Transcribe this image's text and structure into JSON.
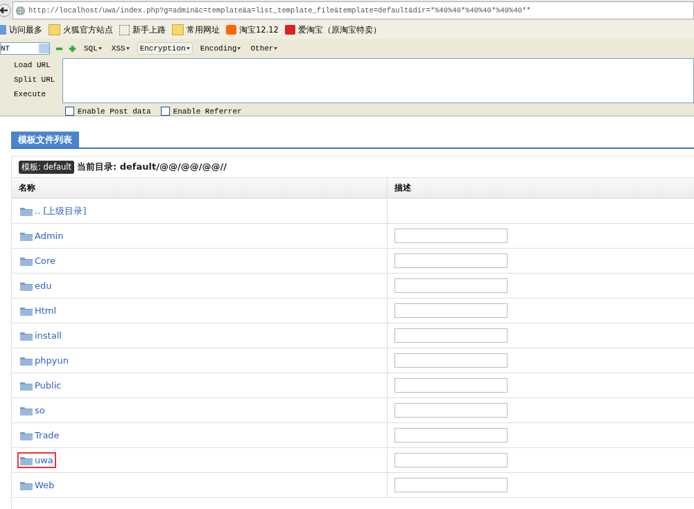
{
  "address_bar": {
    "url": "http://localhost/uwa/index.php?g=admin&c=template&a=list_template_file&template=default&dir=*%40%40*%40%40*%40%40**"
  },
  "bookmarks": [
    {
      "label": "访问最多",
      "kind": "page"
    },
    {
      "label": "火狐官方站点",
      "kind": "folder"
    },
    {
      "label": "新手上路",
      "kind": "dashed"
    },
    {
      "label": "常用网址",
      "kind": "folder"
    },
    {
      "label": "淘宝12.12",
      "kind": "taobao"
    },
    {
      "label": "爱淘宝（原淘宝特卖）",
      "kind": "taobao-red"
    }
  ],
  "hackbar": {
    "select_value": "NT",
    "menus": [
      "SQL",
      "XSS",
      "Encryption",
      "Encoding",
      "Other"
    ],
    "actions": [
      "Load URL",
      "Split URL",
      "Execute"
    ],
    "options": [
      {
        "label": "Enable Post data",
        "checked": false
      },
      {
        "label": "Enable Referrer",
        "checked": false
      }
    ]
  },
  "tab": {
    "label": "模板文件列表"
  },
  "template_badge": "模板: default",
  "current_dir": "当前目录: default/@@/@@/@@//",
  "columns": [
    "名称",
    "描述"
  ],
  "rows": [
    {
      "name": ".. [上级目录]",
      "kind": "parent",
      "highlighted": false
    },
    {
      "name": "Admin",
      "kind": "folder",
      "highlighted": false
    },
    {
      "name": "Core",
      "kind": "folder",
      "highlighted": false
    },
    {
      "name": "edu",
      "kind": "folder",
      "highlighted": false
    },
    {
      "name": "Html",
      "kind": "folder",
      "highlighted": false
    },
    {
      "name": "install",
      "kind": "folder",
      "highlighted": false
    },
    {
      "name": "phpyun",
      "kind": "folder",
      "highlighted": false
    },
    {
      "name": "Public",
      "kind": "folder",
      "highlighted": false
    },
    {
      "name": "so",
      "kind": "folder",
      "highlighted": false
    },
    {
      "name": "Trade",
      "kind": "folder",
      "highlighted": false
    },
    {
      "name": "uwa",
      "kind": "folder",
      "highlighted": true
    },
    {
      "name": "Web",
      "kind": "folder",
      "highlighted": false
    }
  ]
}
